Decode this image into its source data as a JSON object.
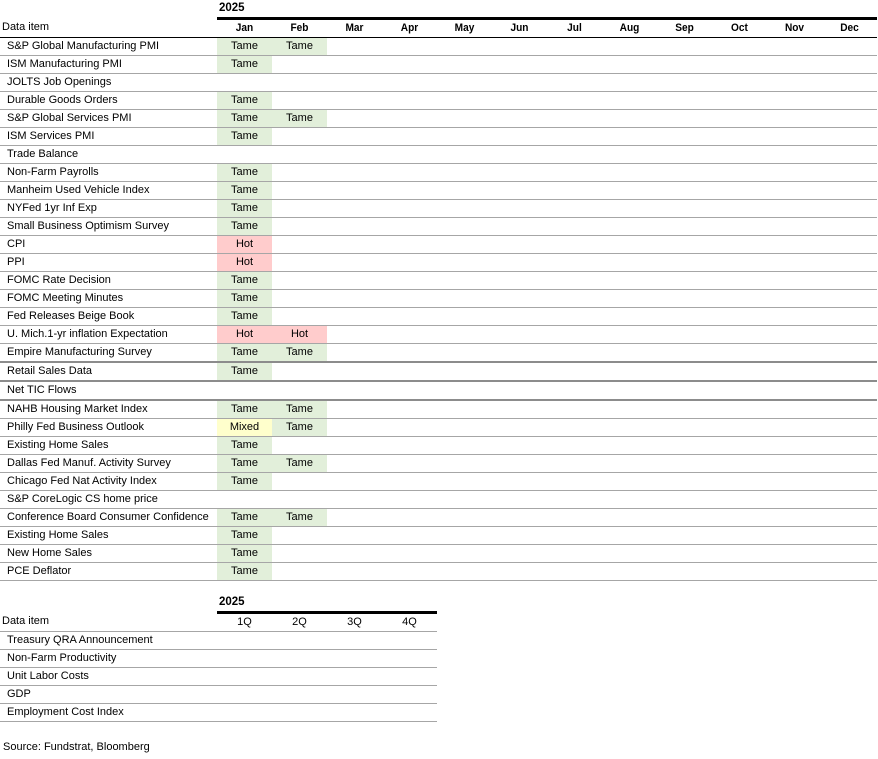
{
  "monthly_table": {
    "year": "2025",
    "label_header": "Data item",
    "months": [
      "Jan",
      "Feb",
      "Mar",
      "Apr",
      "May",
      "Jun",
      "Jul",
      "Aug",
      "Sep",
      "Oct",
      "Nov",
      "Dec"
    ],
    "rows": [
      {
        "item": "S&P Global Manufacturing PMI",
        "values": [
          "Tame",
          "Tame"
        ]
      },
      {
        "item": "ISM Manufacturing PMI",
        "values": [
          "Tame"
        ]
      },
      {
        "item": "JOLTS Job Openings",
        "values": []
      },
      {
        "item": "Durable Goods Orders",
        "values": [
          "Tame"
        ]
      },
      {
        "item": "S&P Global Services PMI",
        "values": [
          "Tame",
          "Tame"
        ]
      },
      {
        "item": "ISM Services PMI",
        "values": [
          "Tame"
        ]
      },
      {
        "item": "Trade Balance",
        "values": []
      },
      {
        "item": "Non-Farm Payrolls",
        "values": [
          "Tame"
        ]
      },
      {
        "item": "Manheim Used Vehicle Index",
        "values": [
          "Tame"
        ]
      },
      {
        "item": "NYFed 1yr Inf Exp",
        "values": [
          "Tame"
        ]
      },
      {
        "item": "Small Business Optimism Survey",
        "values": [
          "Tame"
        ]
      },
      {
        "item": "CPI",
        "values": [
          "Hot"
        ]
      },
      {
        "item": "PPI",
        "values": [
          "Hot"
        ]
      },
      {
        "item": "FOMC Rate Decision",
        "values": [
          "Tame"
        ]
      },
      {
        "item": "FOMC Meeting Minutes",
        "values": [
          "Tame"
        ]
      },
      {
        "item": "Fed Releases Beige Book",
        "values": [
          "Tame"
        ]
      },
      {
        "item": "U. Mich.1-yr  inflation Expectation",
        "values": [
          "Hot",
          "Hot"
        ]
      },
      {
        "item": "Empire Manufacturing Survey",
        "values": [
          "Tame",
          "Tame"
        ],
        "thick_bottom": true
      },
      {
        "item": "Retail Sales Data",
        "values": [
          "Tame"
        ],
        "thick_bottom": true
      },
      {
        "item": "Net TIC Flows",
        "values": [],
        "thick_bottom": true
      },
      {
        "item": "NAHB Housing Market Index",
        "values": [
          "Tame",
          "Tame"
        ]
      },
      {
        "item": "Philly Fed Business Outlook",
        "values": [
          "Mixed",
          "Tame"
        ]
      },
      {
        "item": "Existing Home Sales",
        "values": [
          "Tame"
        ]
      },
      {
        "item": "Dallas Fed Manuf. Activity Survey",
        "values": [
          "Tame",
          "Tame"
        ]
      },
      {
        "item": "Chicago Fed Nat Activity Index",
        "values": [
          "Tame"
        ]
      },
      {
        "item": "S&P CoreLogic CS home price",
        "values": []
      },
      {
        "item": "Conference Board Consumer Confidence",
        "values": [
          "Tame",
          "Tame"
        ]
      },
      {
        "item": "Existing Home Sales",
        "values": [
          "Tame"
        ]
      },
      {
        "item": "New Home Sales",
        "values": [
          "Tame"
        ]
      },
      {
        "item": "PCE Deflator",
        "values": [
          "Tame"
        ]
      }
    ]
  },
  "quarterly_table": {
    "year": "2025",
    "label_header": "Data item",
    "quarters": [
      "1Q",
      "2Q",
      "3Q",
      "4Q"
    ],
    "rows": [
      {
        "item": "Treasury QRA Announcement",
        "values": []
      },
      {
        "item": "Non-Farm Productivity",
        "values": []
      },
      {
        "item": "Unit Labor Costs",
        "values": []
      },
      {
        "item": "GDP",
        "values": []
      },
      {
        "item": "Employment Cost Index",
        "values": []
      }
    ]
  },
  "status_colors": {
    "Tame": "#e2efda",
    "Hot": "#ffcccc",
    "Mixed": "#ffffcc"
  },
  "source": "Source: Fundstrat, Bloomberg"
}
